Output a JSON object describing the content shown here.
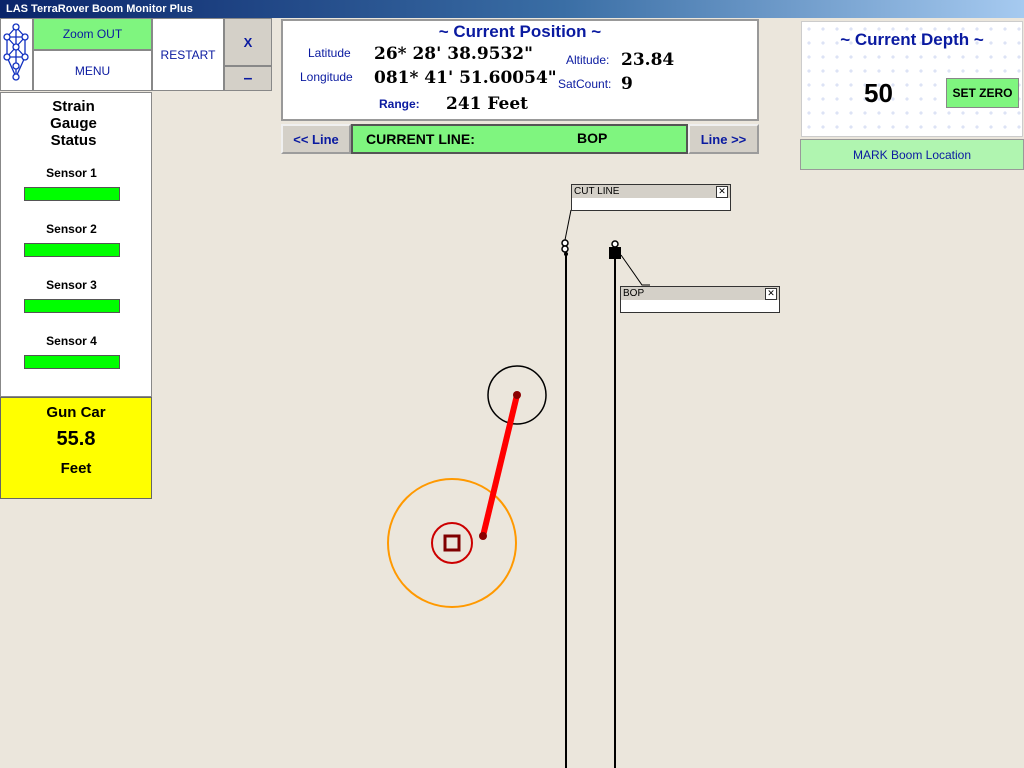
{
  "window": {
    "title": "LAS TerraRover Boom Monitor Plus"
  },
  "toolbar": {
    "zoom_out_label": "Zoom OUT",
    "menu_label": "MENU",
    "restart_label": "RESTART",
    "close_label": "X",
    "minimize_label": "–",
    "logo_icon": "tree-of-life-icon"
  },
  "position": {
    "title": "~ Current Position ~",
    "latitude_label": "Latitude",
    "latitude_value": "26* 28' 38.9532\"",
    "longitude_label": "Longitude",
    "longitude_value": "081* 41' 51.60054\"",
    "altitude_label": "Altitude:",
    "altitude_value": "23.84",
    "satcount_label": "SatCount:",
    "satcount_value": "9",
    "range_label": "Range:",
    "range_value": "241 Feet"
  },
  "line_nav": {
    "prev_label": "<< Line",
    "next_label": "Line >>",
    "current_label": "CURRENT LINE:",
    "current_value": "BOP"
  },
  "depth": {
    "title": "~ Current Depth ~",
    "value": "50",
    "set_zero_label": "SET ZERO",
    "mark_label": "MARK Boom Location"
  },
  "strain": {
    "title_line1": "Strain",
    "title_line2": "Gauge",
    "title_line3": "Status",
    "sensors": [
      {
        "label": "Sensor 1",
        "status_color": "#00ff00"
      },
      {
        "label": "Sensor 2",
        "status_color": "#00ff00"
      },
      {
        "label": "Sensor 3",
        "status_color": "#00ff00"
      },
      {
        "label": "Sensor 4",
        "status_color": "#00ff00"
      }
    ]
  },
  "gun_car": {
    "title": "Gun Car",
    "value": "55.8",
    "unit": "Feet",
    "bg_color": "#ffff00"
  },
  "map": {
    "callouts": [
      {
        "label": "CUT LINE"
      },
      {
        "label": "BOP"
      }
    ],
    "colors": {
      "boom": "#ff0000",
      "outer_ring": "#ff9900",
      "inner_ring": "#cc0000"
    }
  }
}
